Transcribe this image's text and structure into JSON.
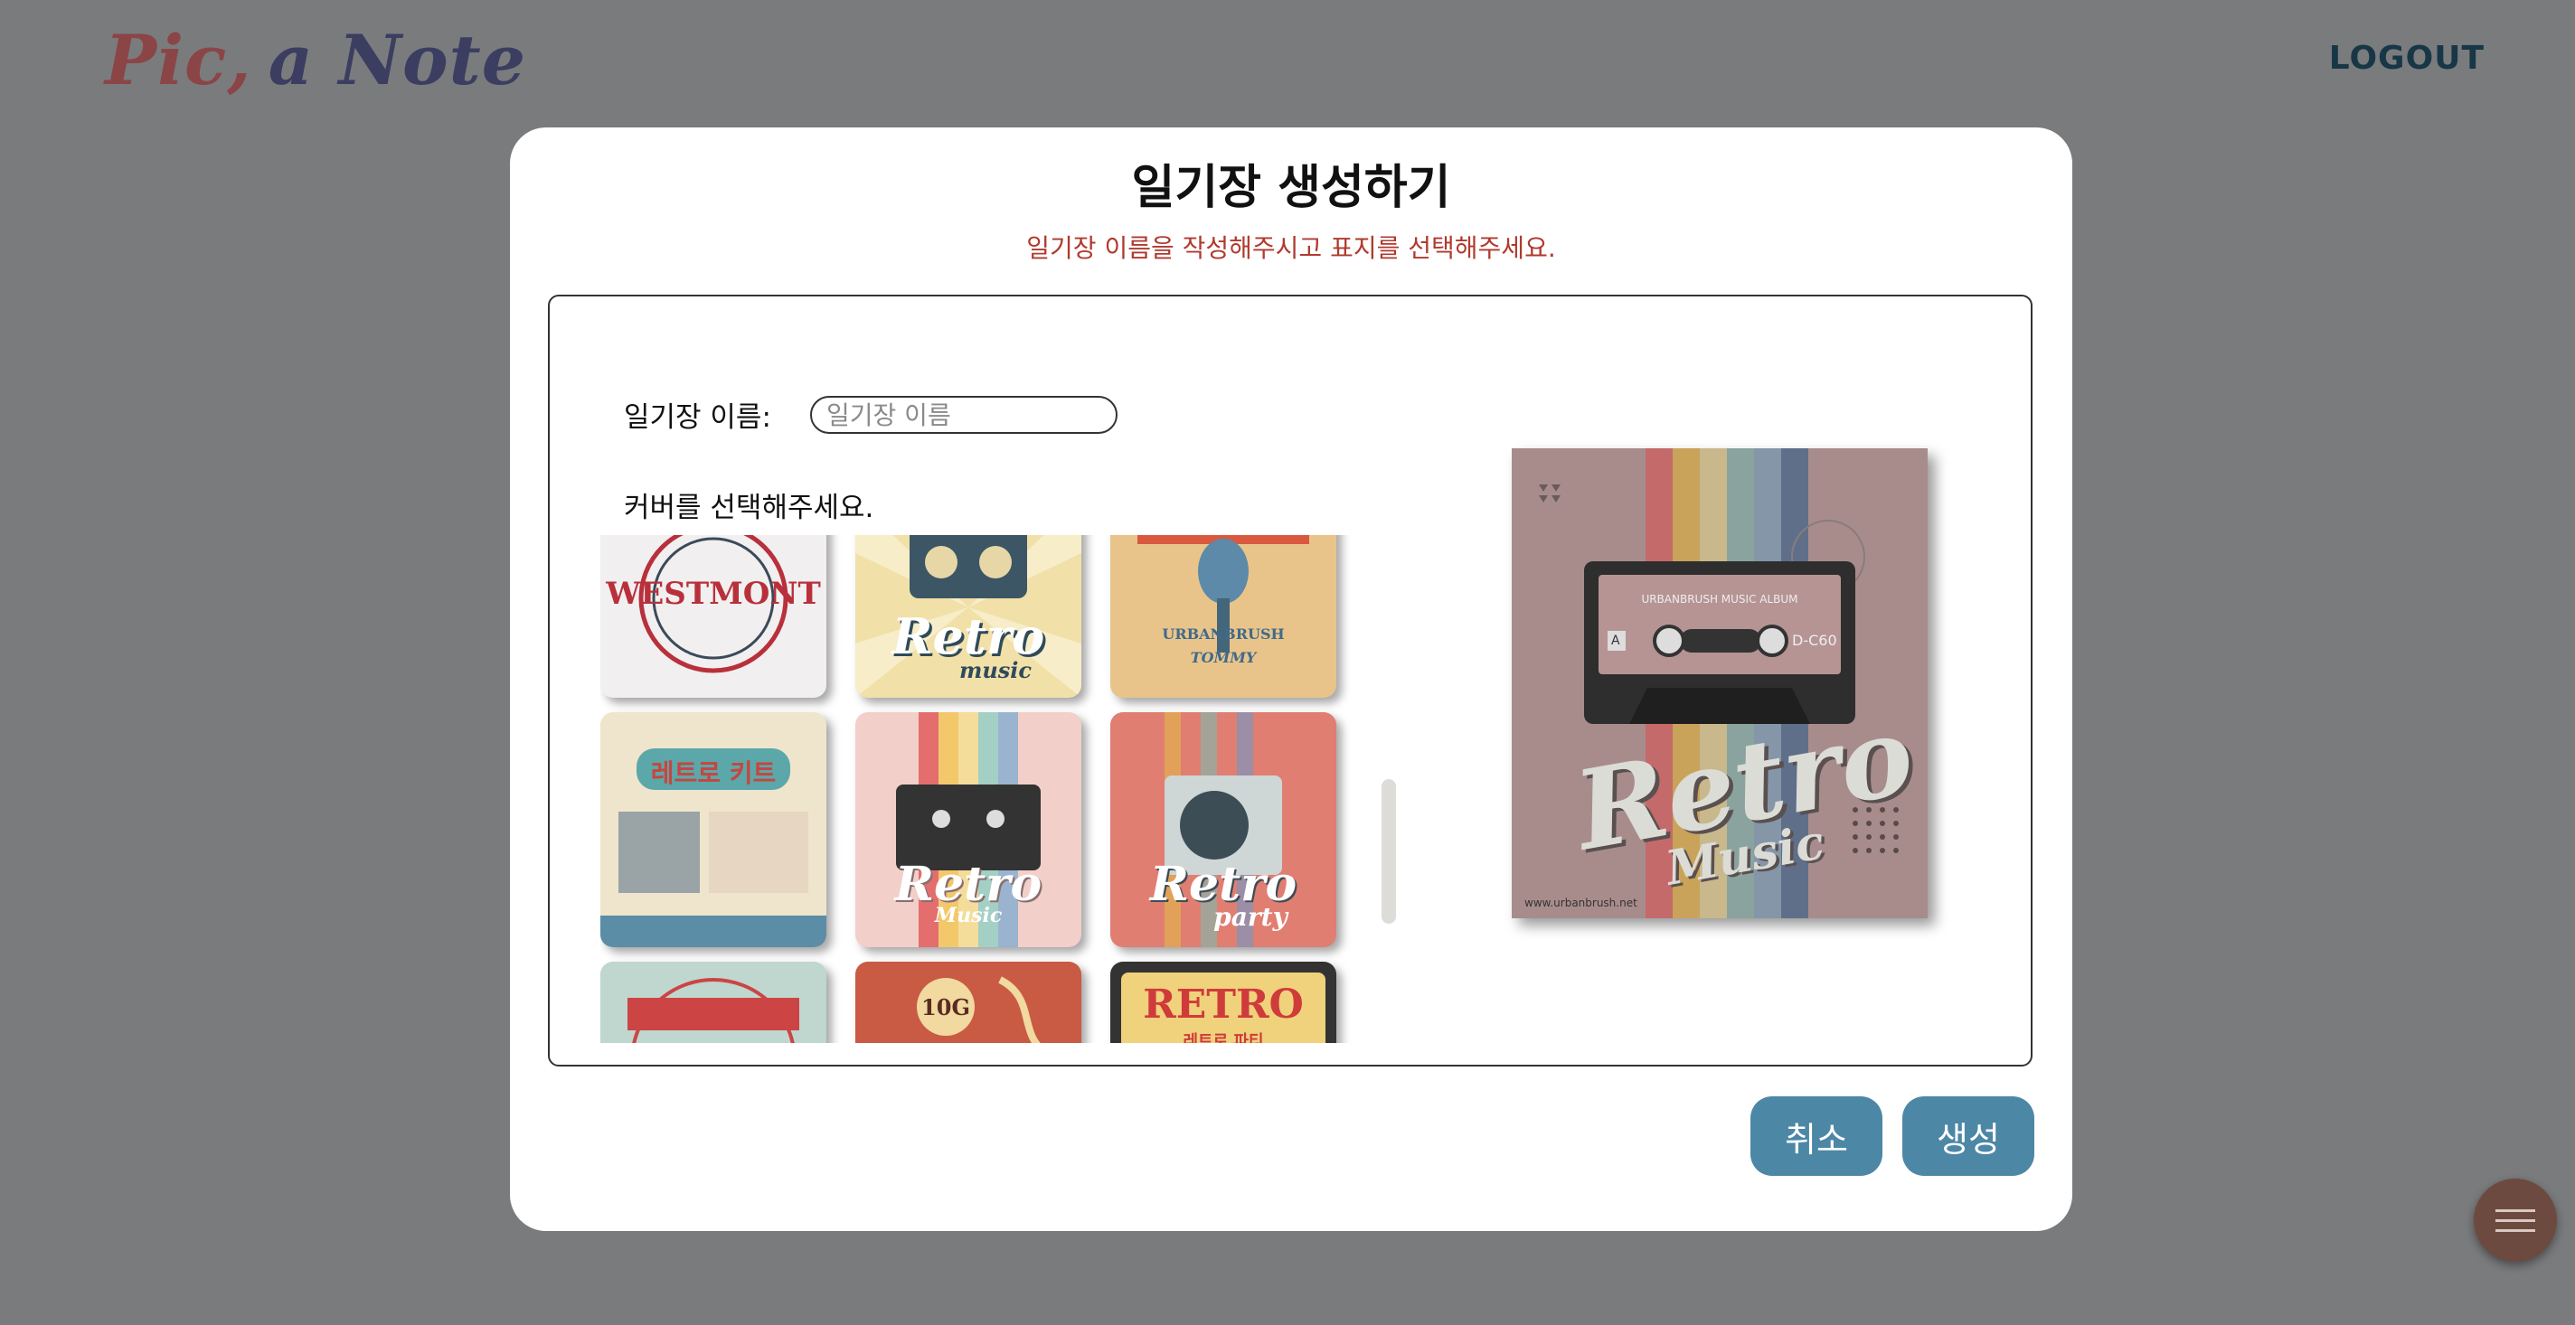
{
  "header": {
    "logo_part1": "Pic,",
    "logo_part2": "a Note",
    "logout_label": "LOGOUT"
  },
  "modal": {
    "title": "일기장 생성하기",
    "subtitle": "일기장 이름을 작성해주시고 표지를 선택해주세요.",
    "name_label": "일기장 이름:",
    "name_placeholder": "일기장 이름",
    "cover_label": "커버를 선택해주세요.",
    "covers": [
      {
        "text": "WESTMONT",
        "sub": "",
        "bg": "#f1efef",
        "fg": "#b8303b"
      },
      {
        "text": "Retro",
        "sub": "music",
        "bg": "#f1e0a8",
        "fg": "#2f4a5a"
      },
      {
        "text": "URBANBRUSH",
        "sub": "TOMMY",
        "bg": "#e9c48a",
        "fg": "#3f6a8a"
      },
      {
        "text": "레트로 키트",
        "sub": "",
        "bg": "#efe5cc",
        "fg": "#c8453f"
      },
      {
        "text": "Retro",
        "sub": "Music",
        "bg": "#f2cfc9",
        "fg": "#ffffff"
      },
      {
        "text": "Retro",
        "sub": "party",
        "bg": "#e07e71",
        "fg": "#ffffff"
      },
      {
        "text": "",
        "sub": "",
        "bg": "#bfd7cf",
        "fg": "#c44"
      },
      {
        "text": "10G",
        "sub": "",
        "bg": "#c95a44",
        "fg": "#f1d9a0"
      },
      {
        "text": "RETRO",
        "sub": "레트로 파티",
        "bg": "#f0d17c",
        "fg": "#cf3b3b"
      }
    ],
    "preview": {
      "title": "Retro",
      "subtitle": "Music",
      "tape_label": "URBANBRUSH MUSIC ALBUM",
      "tape_side": "A",
      "tape_code": "D-C60",
      "footer": "www.urbanbrush.net"
    },
    "cancel_label": "취소",
    "create_label": "생성"
  }
}
